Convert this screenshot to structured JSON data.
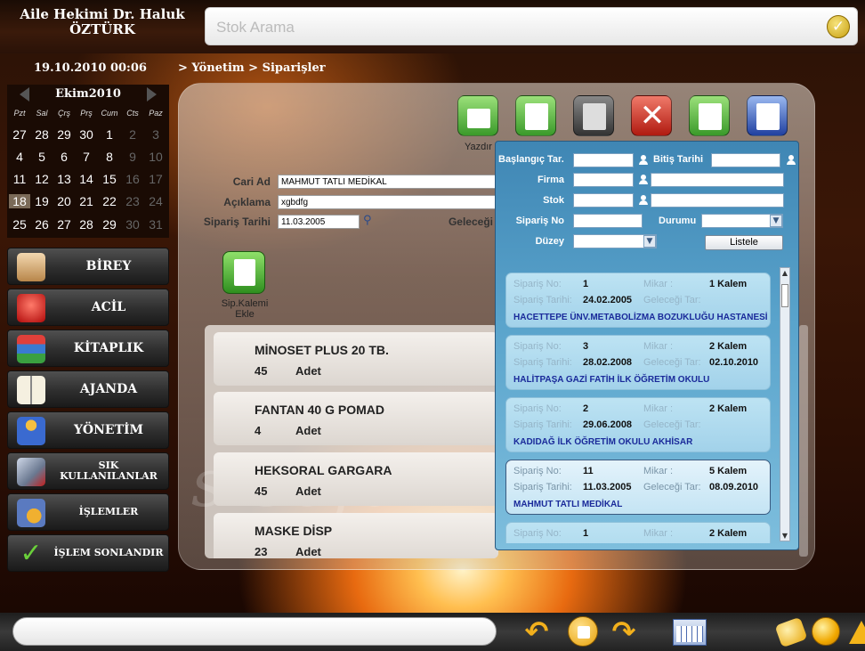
{
  "header": {
    "doctor_line1": "Aile Hekimi Dr. Haluk",
    "doctor_line2": "ÖZTÜRK",
    "search_placeholder": "Stok Arama"
  },
  "status": {
    "datetime": "19.10.2010  00:06",
    "breadcrumb": "> Yönetim > Siparişler"
  },
  "calendar": {
    "month_label": "Ekim2010",
    "day_names": [
      "Pzt",
      "Sal",
      "Çrş",
      "Prş",
      "Cum",
      "Cts",
      "Paz"
    ],
    "weeks": [
      [
        "27",
        "28",
        "29",
        "30",
        "1",
        "2",
        "3"
      ],
      [
        "4",
        "5",
        "6",
        "7",
        "8",
        "9",
        "10"
      ],
      [
        "11",
        "12",
        "13",
        "14",
        "15",
        "16",
        "17"
      ],
      [
        "18",
        "19",
        "20",
        "21",
        "22",
        "23",
        "24"
      ],
      [
        "25",
        "26",
        "27",
        "28",
        "29",
        "30",
        "31"
      ]
    ],
    "today": "18"
  },
  "menu": {
    "items": [
      {
        "label": "BİREY",
        "icon": "person-icon"
      },
      {
        "label": "ACİL",
        "icon": "siren-icon"
      },
      {
        "label": "KİTAPLIK",
        "icon": "books-icon"
      },
      {
        "label": "AJANDA",
        "icon": "open-book-icon"
      },
      {
        "label": "YÖNETİM",
        "icon": "people-icon"
      },
      {
        "label": "SIK KULLANILANLAR",
        "icon": "folders-icon"
      },
      {
        "label": "İŞLEMLER",
        "icon": "person-clock-icon"
      },
      {
        "label": "İŞLEM SONLANDIR",
        "icon": "checkmark-icon"
      }
    ]
  },
  "toolbar": {
    "print_label": "Yazdır"
  },
  "form": {
    "cari_ad_label": "Cari Ad",
    "cari_ad_value": "MAHMUT TATLI MEDİKAL",
    "aciklama_label": "Açıklama",
    "aciklama_value": "xgbdfg",
    "siparis_tarihi_label": "Sipariş Tarihi",
    "siparis_tarihi_value": "11.03.2005",
    "gelecegi_label": "Geleceği"
  },
  "add_item": {
    "label_line1": "Sip.Kalemi",
    "label_line2": "Ekle"
  },
  "order_items": [
    {
      "name": "MİNOSET PLUS 20 TB.",
      "qty": "45",
      "unit": "Adet"
    },
    {
      "name": "FANTAN 40 G POMAD",
      "qty": "4",
      "unit": "Adet"
    },
    {
      "name": "HEKSORAL GARGARA",
      "qty": "45",
      "unit": "Adet"
    },
    {
      "name": "MASKE DİSP",
      "qty": "23",
      "unit": "Adet"
    }
  ],
  "filter": {
    "baslangic_label": "Başlangıç Tar.",
    "bitis_label": "Bitiş Tarihi",
    "firma_label": "Firma",
    "stok_label": "Stok",
    "siparis_no_label": "Sipariş No",
    "durumu_label": "Durumu",
    "duzey_label": "Düzey",
    "listele_label": "Listele"
  },
  "results_labels": {
    "siparis_no": "Sipariş No:",
    "mikar": "Mikar :",
    "siparis_tarihi": "Sipariş Tarihi:",
    "gelecegi_tar": "Geleceği Tar:"
  },
  "results": [
    {
      "no": "1",
      "mikar": "1 Kalem",
      "tarih": "24.02.2005",
      "gelecegi": "",
      "hospital": "HACETTEPE ÜNV.METABOLİZMA BOZUKLUĞU HASTANESİ",
      "selected": false
    },
    {
      "no": "3",
      "mikar": "2 Kalem",
      "tarih": "28.02.2008",
      "gelecegi": "02.10.2010",
      "hospital": "HALİTPAŞA GAZİ FATİH İLK ÖĞRETİM OKULU",
      "selected": false
    },
    {
      "no": "2",
      "mikar": "2 Kalem",
      "tarih": "29.06.2008",
      "gelecegi": "",
      "hospital": "KADIDAĞ İLK ÖĞRETİM OKULU AKHİSAR",
      "selected": false
    },
    {
      "no": "11",
      "mikar": "5 Kalem",
      "tarih": "11.03.2005",
      "gelecegi": "08.09.2010",
      "hospital": "MAHMUT TATLI MEDİKAL",
      "selected": true
    },
    {
      "no": "1",
      "mikar": "2 Kalem",
      "tarih": "",
      "gelecegi": "",
      "hospital": "",
      "selected": false
    }
  ],
  "watermark": "sisofam",
  "colors": {
    "panel_blue": "#5aa4cc",
    "link_blue": "#1a2a9a",
    "accent_orange": "#f2b01c"
  }
}
